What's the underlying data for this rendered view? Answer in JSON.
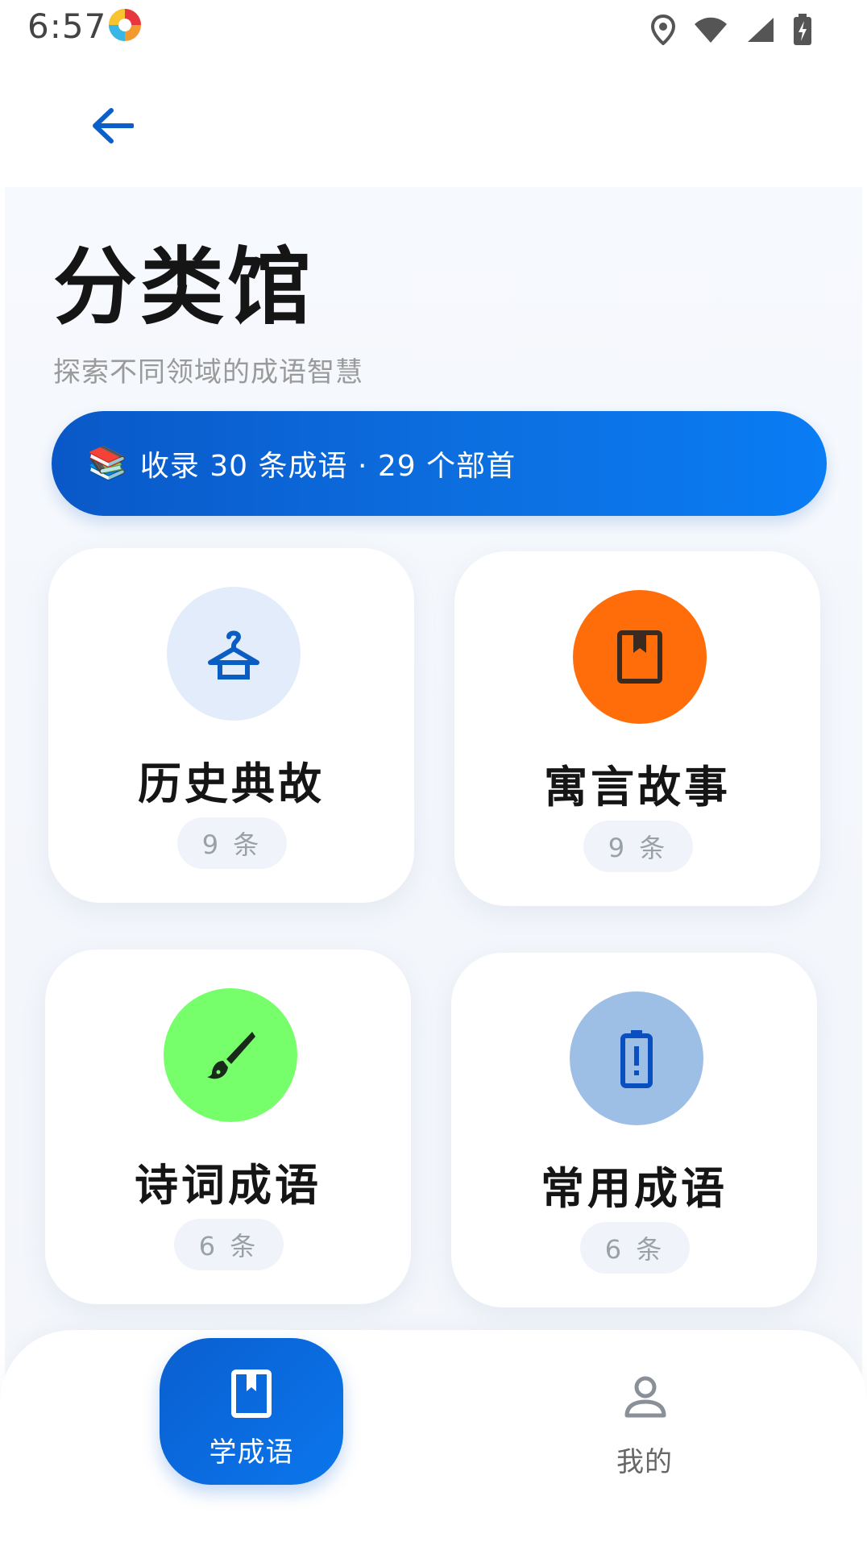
{
  "status_bar": {
    "time": "6:57",
    "icons": [
      "app-logo-icon",
      "location-icon",
      "wifi-icon",
      "signal-icon",
      "battery-charging-icon"
    ]
  },
  "header": {
    "back_icon": "arrow-left-icon"
  },
  "page": {
    "title": "分类馆",
    "subtitle": "探索不同领域的成语智慧"
  },
  "summary": {
    "emoji": "📚",
    "text": "收录 30 条成语 · 29 个部首"
  },
  "categories": [
    {
      "name": "历史典故",
      "count": "9 条",
      "icon": "hanger-icon",
      "color": "#e2ecfa",
      "icon_color": "#0a5dc2"
    },
    {
      "name": "寓言故事",
      "count": "9 条",
      "icon": "book-icon",
      "color": "#ff6d0a",
      "icon_color": "#3a2a20"
    },
    {
      "name": "诗词成语",
      "count": "6 条",
      "icon": "brush-icon",
      "color": "#77ff6b",
      "icon_color": "#1a2a1a"
    },
    {
      "name": "常用成语",
      "count": "6 条",
      "icon": "battery-alert-icon",
      "color": "#9dbfe6",
      "icon_color": "#0a4fc0"
    }
  ],
  "bottom_nav": {
    "items": [
      {
        "label": "学成语",
        "icon": "book-icon",
        "active": true
      },
      {
        "label": "我的",
        "icon": "person-icon",
        "active": false
      }
    ]
  },
  "colors": {
    "accent": "#0b6fe0",
    "background": "#f4f7fb"
  }
}
